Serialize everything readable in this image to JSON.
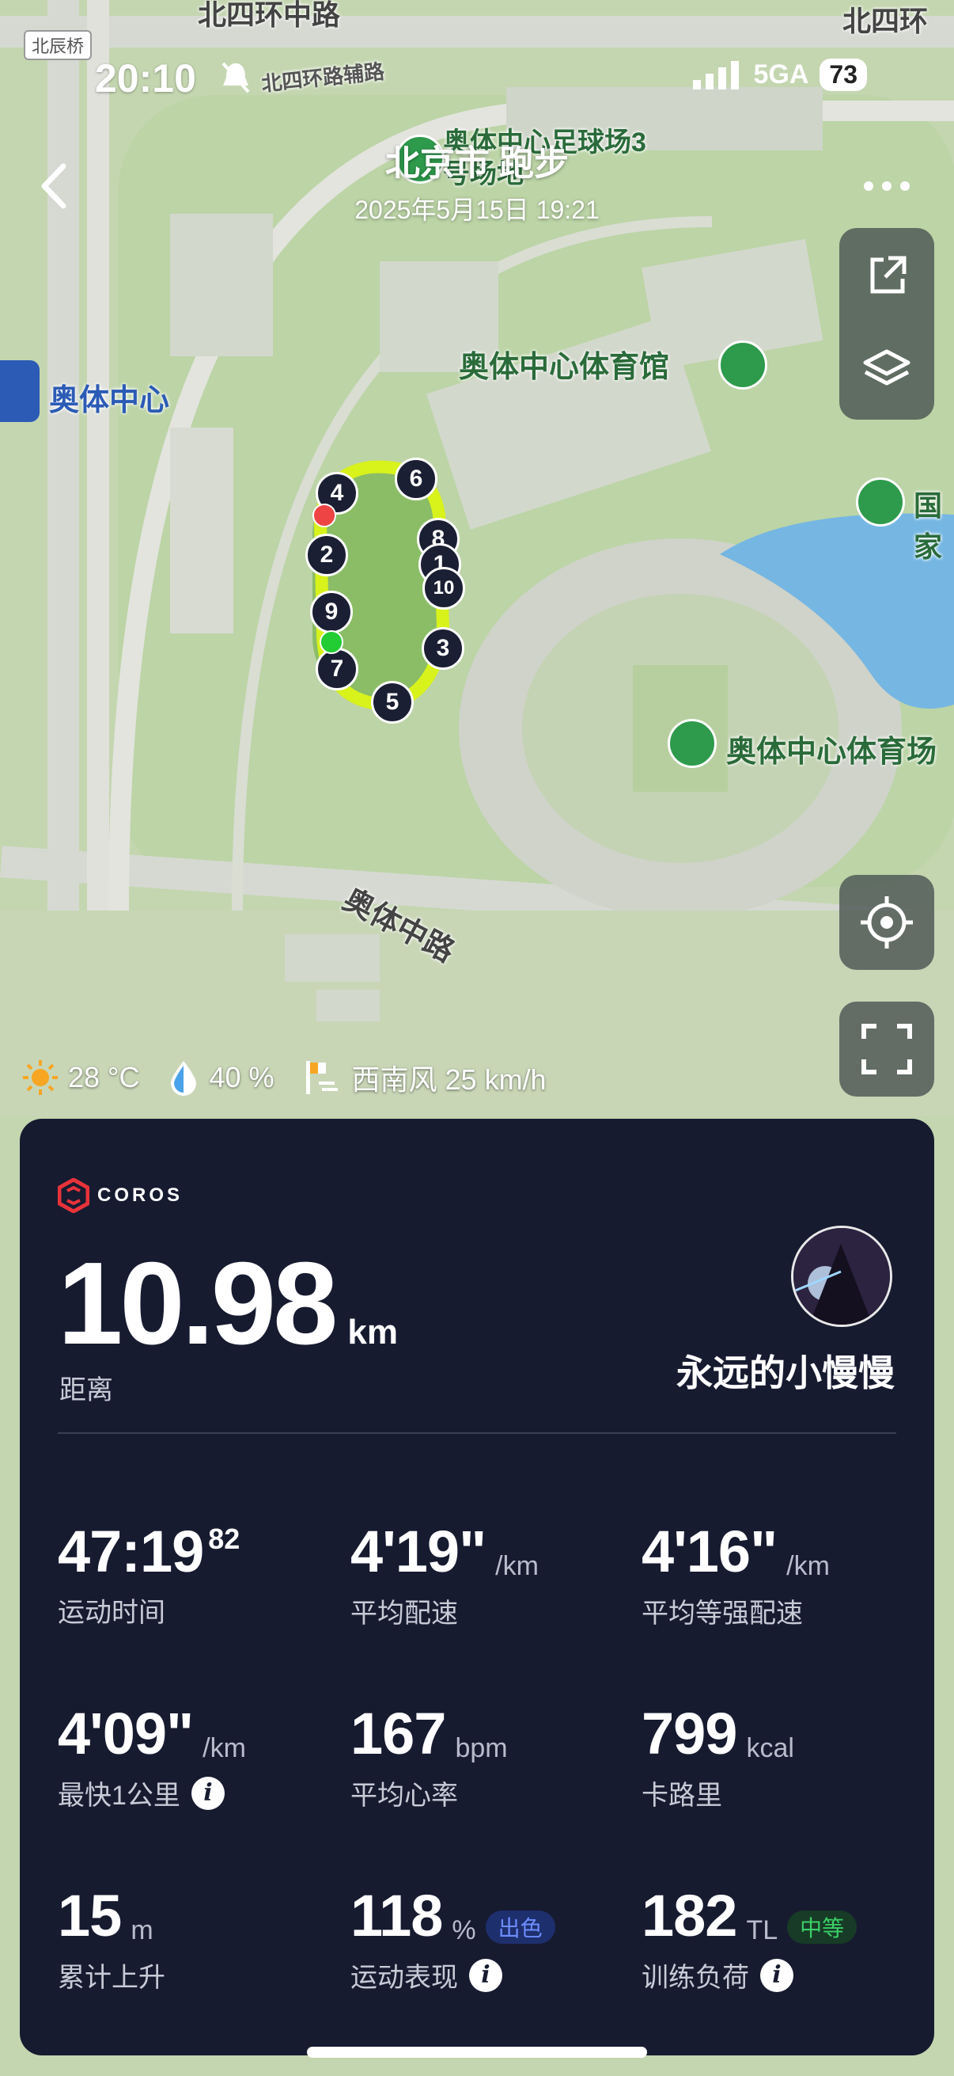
{
  "status_bar": {
    "time": "20:10",
    "network": "5GA",
    "battery": "73"
  },
  "header": {
    "title": "北京市 跑步",
    "subtitle": "2025年5月15日 19:21"
  },
  "map": {
    "labels": {
      "top_road": "北四环中路",
      "top_road_right": "北四环",
      "beichen": "北辰桥",
      "fulu": "北四环路辅路",
      "football": "奥体中心足球场3号场地",
      "gym": "奥体中心体育馆",
      "metro": "奥体中心",
      "guo": "国家",
      "stadium": "奥体中心体育场",
      "aoti_road": "奥体中路"
    },
    "markers": [
      "4",
      "6",
      "8",
      "1",
      "10",
      "2",
      "9",
      "3",
      "7",
      "5"
    ]
  },
  "weather": {
    "temperature": "28 °C",
    "humidity": "40 %",
    "wind": "西南风 25 km/h"
  },
  "card": {
    "brand": "COROS",
    "distance": "10.98",
    "distance_unit": "km",
    "distance_label": "距离",
    "username": "永远的小慢慢",
    "stats": [
      {
        "value": "47:19",
        "sup": "82",
        "unit": "",
        "label": "运动时间"
      },
      {
        "value": "4'19\"",
        "unit": "/km",
        "label": "平均配速"
      },
      {
        "value": "4'16\"",
        "unit": "/km",
        "label": "平均等强配速"
      },
      {
        "value": "4'09\"",
        "unit": "/km",
        "label": "最快1公里"
      },
      {
        "value": "167",
        "unit": "bpm",
        "label": "平均心率"
      },
      {
        "value": "799",
        "unit": "kcal",
        "label": "卡路里"
      },
      {
        "value": "15",
        "unit": "m",
        "label": "累计上升"
      },
      {
        "value": "118",
        "unit": "%",
        "badge": "出色",
        "label": "运动表现"
      },
      {
        "value": "182",
        "unit": "TL",
        "badge": "中等",
        "label": "训练负荷"
      }
    ]
  },
  "colors": {
    "card_bg": "#171b30",
    "route": "#d8f21c",
    "badge_blue": "#6d8dff",
    "badge_green": "#3ccf67",
    "start_dot": "#22cc33",
    "end_dot": "#ee4444"
  }
}
